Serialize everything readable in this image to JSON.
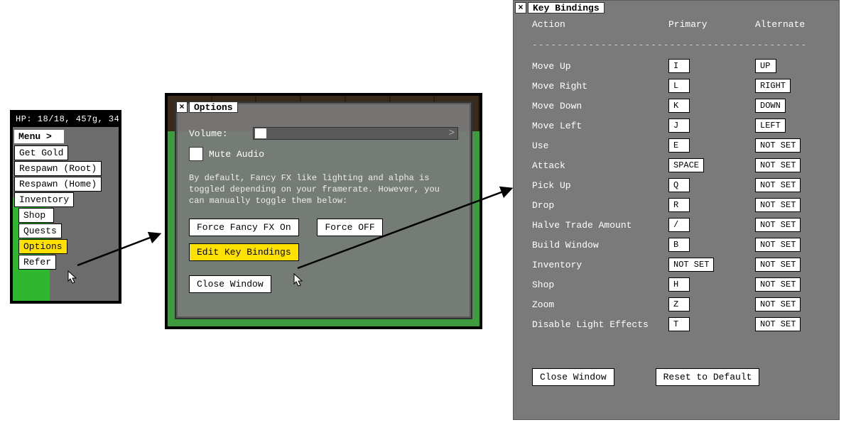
{
  "menu": {
    "hud": "HP: 18/18,  457g, 34",
    "header": "Menu >",
    "items": [
      {
        "label": "Get Gold",
        "selected": false
      },
      {
        "label": "Respawn (Root)",
        "selected": false
      },
      {
        "label": "Respawn (Home)",
        "selected": false
      },
      {
        "label": "Inventory",
        "selected": false
      },
      {
        "label": "Shop",
        "selected": false
      },
      {
        "label": "Quests",
        "selected": false
      },
      {
        "label": "Options",
        "selected": true
      },
      {
        "label": "Refer",
        "selected": false
      }
    ]
  },
  "options": {
    "title": "Options",
    "volume_label": "Volume:",
    "mute_label": "Mute Audio",
    "paragraph": "By default, Fancy FX like lighting and alpha is toggled depending on your framerate. However, you can manually toggle them below:",
    "force_on": "Force Fancy FX On",
    "force_off": "Force OFF",
    "edit_keys": "Edit Key Bindings",
    "close": "Close Window"
  },
  "keybindings": {
    "title": "Key Bindings",
    "col_action": "Action",
    "col_primary": "Primary",
    "col_alternate": "Alternate",
    "dashes": "--------------------------------------------",
    "rows": [
      {
        "action": "Move Up",
        "primary": "I",
        "alt": "UP"
      },
      {
        "action": "Move Right",
        "primary": "L",
        "alt": "RIGHT"
      },
      {
        "action": "Move Down",
        "primary": "K",
        "alt": "DOWN"
      },
      {
        "action": "Move Left",
        "primary": "J",
        "alt": "LEFT"
      },
      {
        "action": "Use",
        "primary": "E",
        "alt": "NOT SET"
      },
      {
        "action": "Attack",
        "primary": "SPACE",
        "alt": "NOT SET"
      },
      {
        "action": "Pick Up",
        "primary": "Q",
        "alt": "NOT SET"
      },
      {
        "action": "Drop",
        "primary": "R",
        "alt": "NOT SET"
      },
      {
        "action": "Halve Trade Amount",
        "primary": "/",
        "alt": "NOT SET"
      },
      {
        "action": "Build Window",
        "primary": "B",
        "alt": "NOT SET"
      },
      {
        "action": "Inventory",
        "primary": "NOT SET",
        "alt": "NOT SET"
      },
      {
        "action": "Shop",
        "primary": "H",
        "alt": "NOT SET"
      },
      {
        "action": "Zoom",
        "primary": "Z",
        "alt": "NOT SET"
      },
      {
        "action": "Disable Light Effects",
        "primary": "T",
        "alt": "NOT SET"
      }
    ],
    "close": "Close Window",
    "reset": "Reset to Default"
  }
}
